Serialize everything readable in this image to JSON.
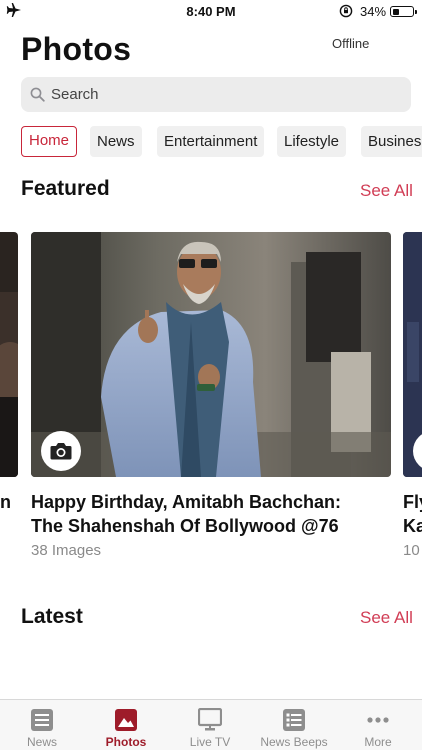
{
  "status_bar": {
    "time": "8:40 PM",
    "battery": "34%",
    "battery_level": 0.34
  },
  "header": {
    "title": "Photos",
    "offline_label": "Offline"
  },
  "search": {
    "placeholder": "Search"
  },
  "tabs": [
    {
      "label": "Home",
      "active": true
    },
    {
      "label": "News",
      "active": false
    },
    {
      "label": "Entertainment",
      "active": false
    },
    {
      "label": "Lifestyle",
      "active": false
    },
    {
      "label": "Busines",
      "active": false
    }
  ],
  "featured": {
    "title": "Featured",
    "see_all": "See All",
    "cards": [
      {
        "title_line1": "n",
        "title_line2": "",
        "count": ""
      },
      {
        "title_line1": "Happy Birthday, Amitabh Bachchan:",
        "title_line2": "The Shahenshah Of Bollywood @76",
        "count": "38 Images"
      },
      {
        "title_line1": "Fly",
        "title_line2": "Ka",
        "count": "10"
      }
    ]
  },
  "latest": {
    "title": "Latest",
    "see_all": "See All"
  },
  "tabbar": [
    {
      "label": "News",
      "icon": "news-icon",
      "active": false
    },
    {
      "label": "Photos",
      "icon": "photos-icon",
      "active": true
    },
    {
      "label": "Live TV",
      "icon": "tv-icon",
      "active": false
    },
    {
      "label": "News Beeps",
      "icon": "list-icon",
      "active": false
    },
    {
      "label": "More",
      "icon": "more-icon",
      "active": false
    }
  ],
  "colors": {
    "accent": "#c8263a",
    "active_tab": "#9e1c2a",
    "see_all": "#d13d55"
  }
}
